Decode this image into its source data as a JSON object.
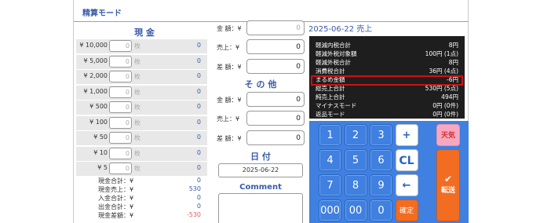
{
  "screen_title": "精算モード",
  "cash": {
    "heading": "現 金",
    "rows": [
      {
        "label": "¥ 10,000",
        "count": "0",
        "unit": "枚",
        "amount": "0"
      },
      {
        "label": "¥ 5,000",
        "count": "0",
        "unit": "枚",
        "amount": "0"
      },
      {
        "label": "¥ 2,000",
        "count": "0",
        "unit": "枚",
        "amount": "0"
      },
      {
        "label": "¥ 1,000",
        "count": "0",
        "unit": "枚",
        "amount": "0"
      },
      {
        "label": "¥ 500",
        "count": "0",
        "unit": "枚",
        "amount": "0"
      },
      {
        "label": "¥ 100",
        "count": "0",
        "unit": "枚",
        "amount": "0"
      },
      {
        "label": "¥ 50",
        "count": "0",
        "unit": "枚",
        "amount": "0"
      },
      {
        "label": "¥ 10",
        "count": "0",
        "unit": "枚",
        "amount": "0"
      },
      {
        "label": "¥ 5",
        "count": "0",
        "unit": "枚",
        "amount": "0"
      }
    ],
    "summary": [
      {
        "label": "現金合計：¥",
        "amount": "0"
      },
      {
        "label": "現金売上：¥",
        "amount": "530"
      },
      {
        "label": "入金合計：¥",
        "amount": "0"
      },
      {
        "label": "出金合計：¥",
        "amount": "0"
      },
      {
        "label": "現金差額：¥",
        "amount": "-530"
      }
    ]
  },
  "middle": {
    "top": [
      {
        "label": "金 額：¥",
        "value": "0"
      },
      {
        "label": "売上：¥",
        "value": "0"
      },
      {
        "label": "差 額：¥",
        "value": "0"
      }
    ],
    "other_heading": "そ の 他",
    "other": [
      {
        "label": "金 額：¥",
        "value": "0"
      },
      {
        "label": "売上：¥",
        "value": "0"
      },
      {
        "label": "差 額：¥",
        "value": "0"
      }
    ],
    "date_heading": "日 付",
    "date_value": "2025-06-22",
    "comment_heading": "Comment"
  },
  "report": {
    "heading": "2025-06-22 売上",
    "rows": [
      {
        "k": "軽減内税合計",
        "v": "8円"
      },
      {
        "k": "軽減外税対象額",
        "v": "100円 (1点)"
      },
      {
        "k": "軽減外税合計",
        "v": "8円"
      },
      {
        "k": "消費税合計",
        "v": "36円 (4点)"
      },
      {
        "k": "まるめ金額",
        "v": "-6円"
      },
      {
        "k": "総売上合計",
        "v": "530円 (5点)"
      },
      {
        "k": "純売上合計",
        "v": "494円"
      },
      {
        "k": "マイナスモード",
        "v": "0円 (0件)"
      },
      {
        "k": "返品モード",
        "v": "0円 (0件)"
      }
    ]
  },
  "keypad": {
    "keys": [
      "1",
      "2",
      "3",
      "+",
      "4",
      "5",
      "6",
      "CL",
      "7",
      "8",
      "9",
      "←",
      "000",
      "00",
      "0",
      "確定"
    ],
    "weather": "天気",
    "transfer_check": "✔",
    "transfer": "転送"
  },
  "colors": {
    "accent": "#3a5ba8",
    "keypad": "#3f80e0",
    "orange": "#f26d21",
    "highlight": "#d01010"
  }
}
